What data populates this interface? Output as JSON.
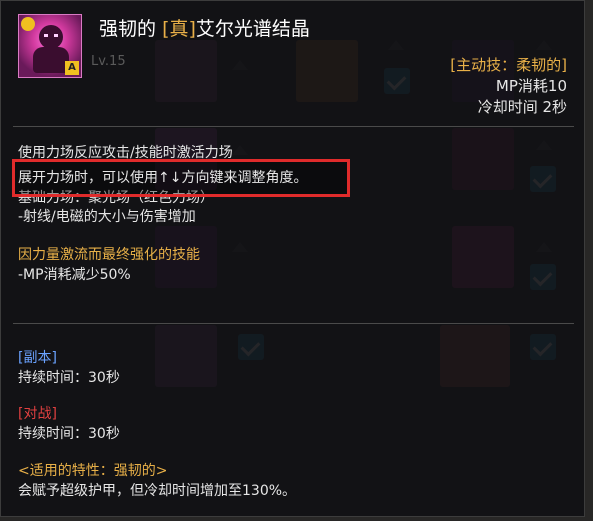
{
  "skill": {
    "title_prefix": "强韧的",
    "title_tag": "[真]",
    "title_name": "艾尔光谱结晶",
    "type_label": "[主动技：柔韧的]",
    "mp_cost": "MP消耗10",
    "cooldown": "冷却时间 2秒",
    "level_ghost": "Lv.15"
  },
  "description": {
    "line1": "使用力场反应攻击/技能时激活力场",
    "highlight": "展开力场时，可以使用↑↓方向键来调整角度。",
    "line3": "基础力场：聚光场（红色力场）",
    "line4": "-射线/电磁的大小与伤害增加",
    "enhance_title": "因力量激流而最终强化的技能",
    "enhance_detail": "-MP消耗减少50%"
  },
  "dungeon": {
    "label": "[副本]",
    "duration": "持续时间：30秒"
  },
  "pvp": {
    "label": "[对战]",
    "duration": "持续时间：30秒"
  },
  "trait": {
    "label": "<适用的特性：强韧的>",
    "effect": "会赋予超级护甲，但冷却时间增加至130%。"
  },
  "colors": {
    "gold": "#e8b048",
    "blue": "#6aa2ff",
    "red": "#e04040",
    "highlight_border": "#e02b2b"
  }
}
